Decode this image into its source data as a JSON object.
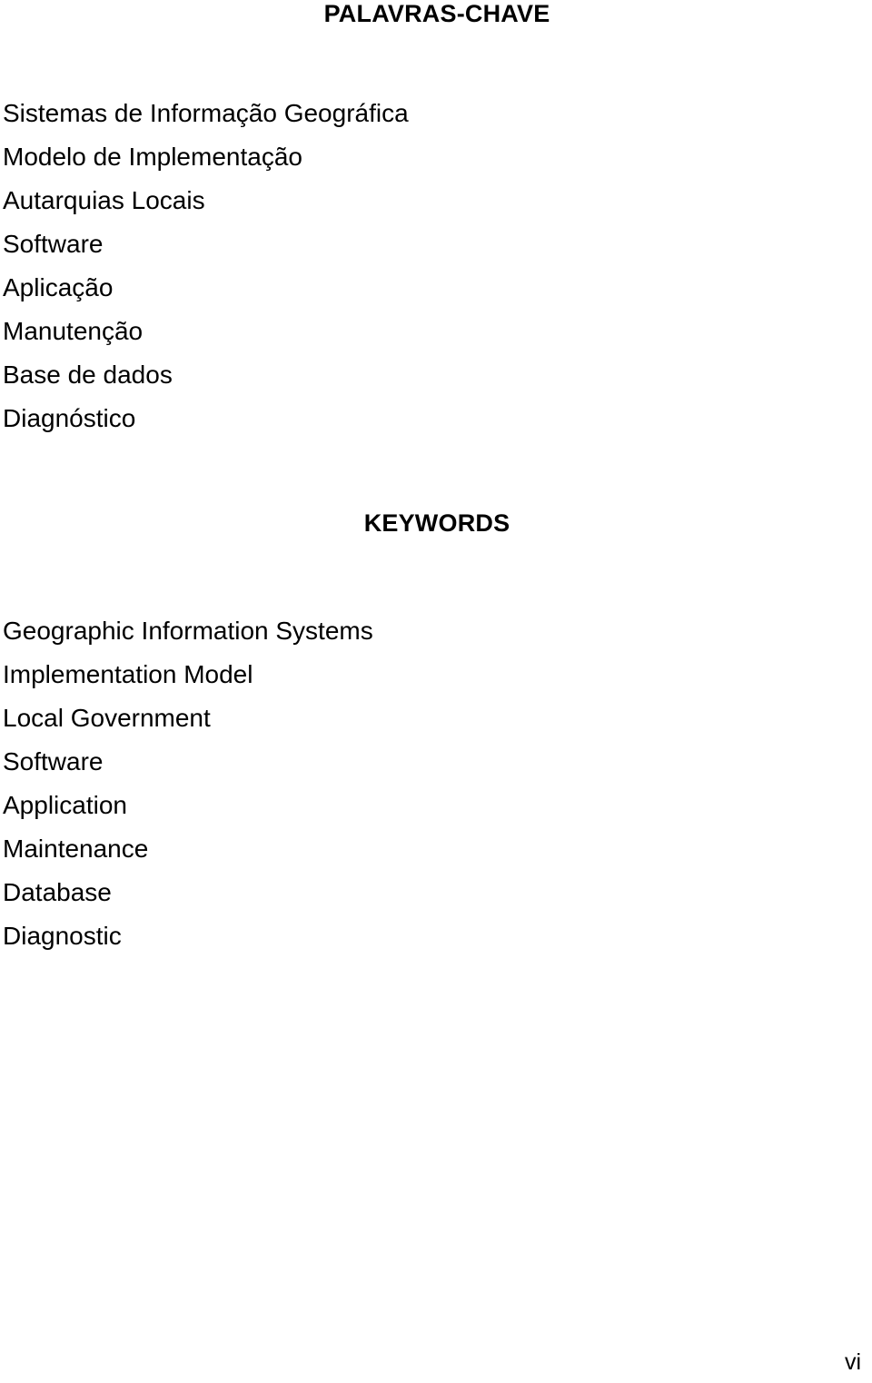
{
  "document": {
    "page_number": "vi",
    "background_color": "#ffffff",
    "text_color": "#000000"
  },
  "sections": {
    "portuguese": {
      "heading": "PALAVRAS-CHAVE",
      "keywords": [
        "Sistemas de Informação Geográfica",
        "Modelo de Implementação",
        "Autarquias Locais",
        "Software",
        "Aplicação",
        "Manutenção",
        "Base de dados",
        "Diagnóstico"
      ]
    },
    "english": {
      "heading": "KEYWORDS",
      "keywords": [
        "Geographic Information Systems",
        "Implementation Model",
        "Local Government",
        "Software",
        "Application",
        "Maintenance",
        "Database",
        "Diagnostic"
      ]
    }
  }
}
